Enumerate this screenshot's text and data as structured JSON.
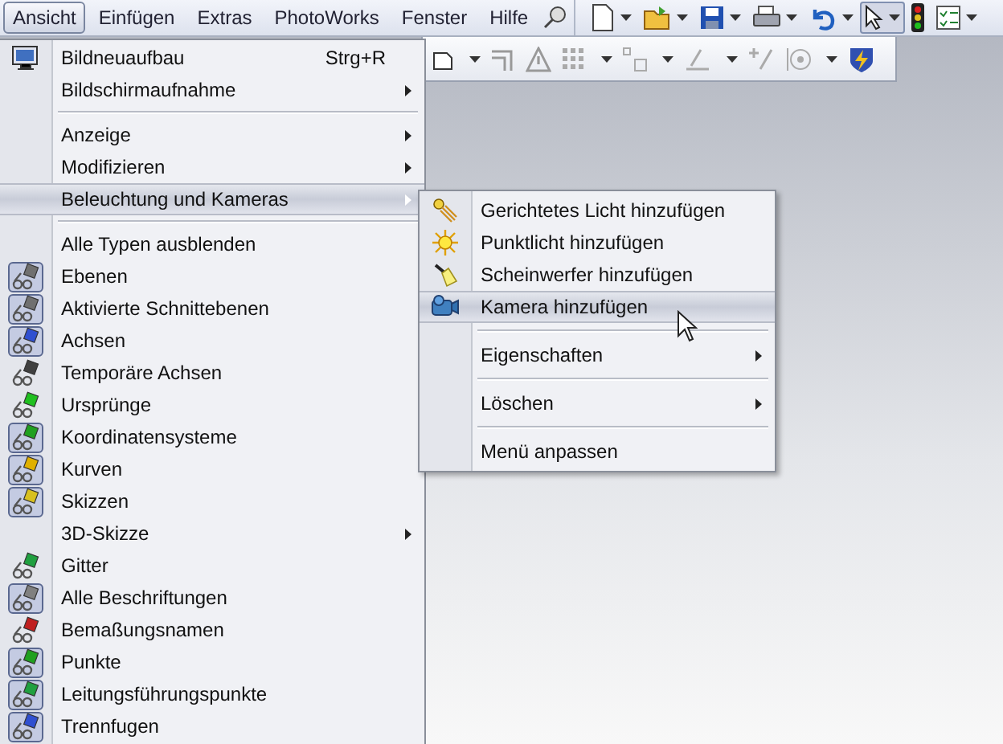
{
  "menubar": [
    {
      "label": "Ansicht",
      "selected": true
    },
    {
      "label": "Einfügen",
      "selected": false
    },
    {
      "label": "Extras",
      "selected": false
    },
    {
      "label": "PhotoWorks",
      "selected": false
    },
    {
      "label": "Fenster",
      "selected": false
    },
    {
      "label": "Hilfe",
      "selected": false
    }
  ],
  "menu": [
    {
      "kind": "command",
      "label": "Bildneuaufbau",
      "shortcut": "Strg+R",
      "submenu": false,
      "selected": false
    },
    {
      "kind": "plain",
      "label": "Bildschirmaufnahme",
      "submenu": true,
      "selected": false
    },
    {
      "kind": "separator"
    },
    {
      "kind": "plain",
      "label": "Anzeige",
      "submenu": true,
      "selected": false
    },
    {
      "kind": "plain",
      "label": "Modifizieren",
      "submenu": true,
      "selected": false
    },
    {
      "kind": "plain",
      "label": "Beleuchtung und Kameras",
      "submenu": true,
      "selected": true
    },
    {
      "kind": "separator"
    },
    {
      "kind": "plain",
      "label": "Alle Typen ausblenden",
      "submenu": false,
      "selected": false
    },
    {
      "kind": "toggle",
      "label": "Ebenen",
      "checked": true,
      "submenu": false,
      "selected": false
    },
    {
      "kind": "toggle",
      "label": "Aktivierte Schnittebenen",
      "checked": true,
      "submenu": false,
      "selected": false
    },
    {
      "kind": "toggle",
      "label": "Achsen",
      "checked": true,
      "submenu": false,
      "selected": false
    },
    {
      "kind": "toggle",
      "label": "Temporäre Achsen",
      "checked": false,
      "submenu": false,
      "selected": false
    },
    {
      "kind": "toggle",
      "label": "Ursprünge",
      "checked": false,
      "submenu": false,
      "selected": false
    },
    {
      "kind": "toggle",
      "label": "Koordinatensysteme",
      "checked": true,
      "submenu": false,
      "selected": false
    },
    {
      "kind": "toggle",
      "label": "Kurven",
      "checked": true,
      "submenu": false,
      "selected": false
    },
    {
      "kind": "toggle",
      "label": "Skizzen",
      "checked": true,
      "submenu": false,
      "selected": false
    },
    {
      "kind": "plain",
      "label": "3D-Skizze",
      "submenu": true,
      "selected": false
    },
    {
      "kind": "toggle",
      "label": "Gitter",
      "checked": false,
      "submenu": false,
      "selected": false
    },
    {
      "kind": "toggle",
      "label": "Alle Beschriftungen",
      "checked": true,
      "submenu": false,
      "selected": false
    },
    {
      "kind": "toggle",
      "label": "Bemaßungsnamen",
      "checked": false,
      "submenu": false,
      "selected": false
    },
    {
      "kind": "toggle",
      "label": "Punkte",
      "checked": true,
      "submenu": false,
      "selected": false
    },
    {
      "kind": "toggle",
      "label": "Leitungsführungspunkte",
      "checked": true,
      "submenu": false,
      "selected": false
    },
    {
      "kind": "toggle",
      "label": "Trennfugen",
      "checked": true,
      "submenu": false,
      "selected": false
    }
  ],
  "submenu": [
    {
      "kind": "directional-light",
      "label": "Gerichtetes Licht hinzufügen",
      "submenu": false,
      "selected": false
    },
    {
      "kind": "point-light",
      "label": "Punktlicht hinzufügen",
      "submenu": false,
      "selected": false
    },
    {
      "kind": "spotlight",
      "label": "Scheinwerfer hinzufügen",
      "submenu": false,
      "selected": false
    },
    {
      "kind": "camera",
      "label": "Kamera hinzufügen",
      "submenu": false,
      "selected": true
    },
    {
      "kind": "separator"
    },
    {
      "kind": "plain",
      "label": "Eigenschaften",
      "submenu": true,
      "selected": false
    },
    {
      "kind": "separator"
    },
    {
      "kind": "plain",
      "label": "Löschen",
      "submenu": true,
      "selected": false
    },
    {
      "kind": "separator"
    },
    {
      "kind": "plain",
      "label": "Menü anpassen",
      "submenu": false,
      "selected": false
    }
  ]
}
